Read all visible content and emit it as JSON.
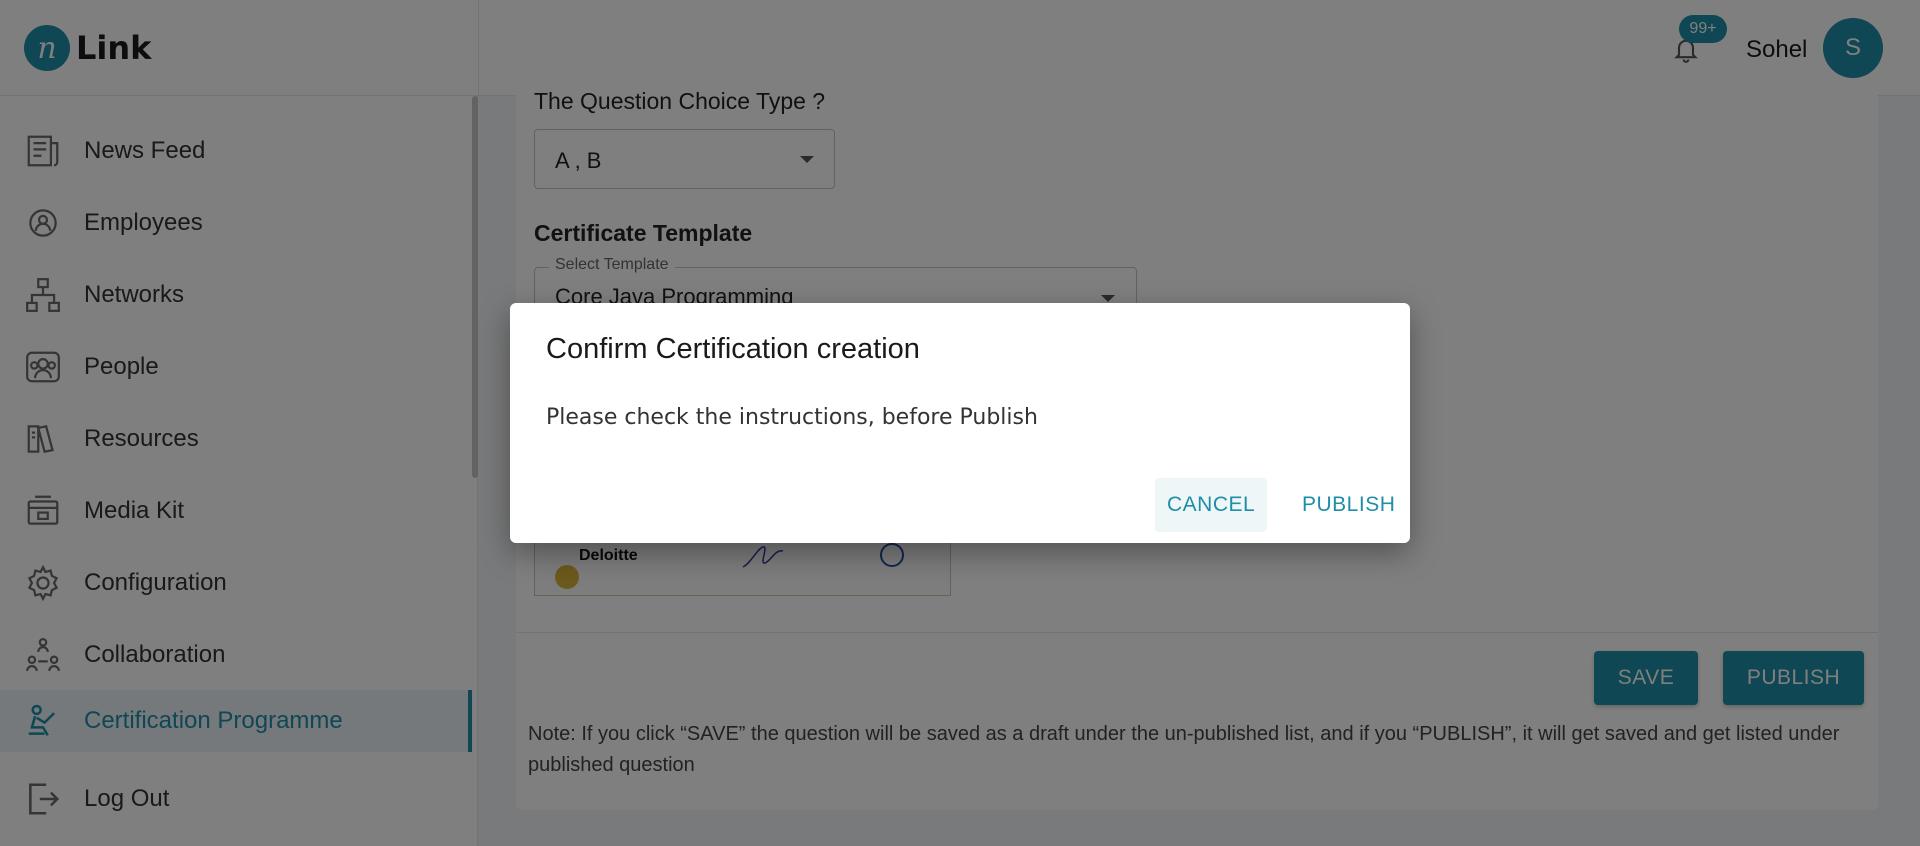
{
  "header": {
    "logo_letter": "n",
    "logo_text": "Link",
    "notifications_badge": "99+",
    "user_name": "Sohel",
    "avatar_initial": "S"
  },
  "sidebar": {
    "items": [
      {
        "label": "News Feed",
        "icon": "news-feed-icon"
      },
      {
        "label": "Employees",
        "icon": "employees-icon"
      },
      {
        "label": "Networks",
        "icon": "networks-icon"
      },
      {
        "label": "People",
        "icon": "people-icon"
      },
      {
        "label": "Resources",
        "icon": "resources-icon"
      },
      {
        "label": "Media Kit",
        "icon": "media-kit-icon"
      },
      {
        "label": "Configuration",
        "icon": "gear-icon"
      },
      {
        "label": "Collaboration",
        "icon": "collaboration-icon"
      },
      {
        "label": "Certification Programme",
        "icon": "certification-icon",
        "active": true
      },
      {
        "label": "Log Out",
        "icon": "logout-icon"
      }
    ]
  },
  "form": {
    "question_choice_label": "The Question Choice Type ?",
    "question_choice_value": "A , B",
    "certificate_template_label": "Certificate Template",
    "template_field_label": "Select Template",
    "template_value": "Core Java Programming",
    "certificate_preview_org": "Deloitte"
  },
  "actions": {
    "save_label": "SAVE",
    "publish_label": "PUBLISH",
    "note": "Note: If you click “SAVE” the question will be saved as a draft under the un-published list, and if you “PUBLISH”, it will get saved and get listed under published question"
  },
  "dialog": {
    "title": "Confirm Certification creation",
    "message": "Please check the instructions, before Publish",
    "cancel_label": "CANCEL",
    "publish_label": "PUBLISH"
  },
  "colors": {
    "accent": "#1f8ea8",
    "overlay": "rgba(0,0,0,0.5)"
  }
}
